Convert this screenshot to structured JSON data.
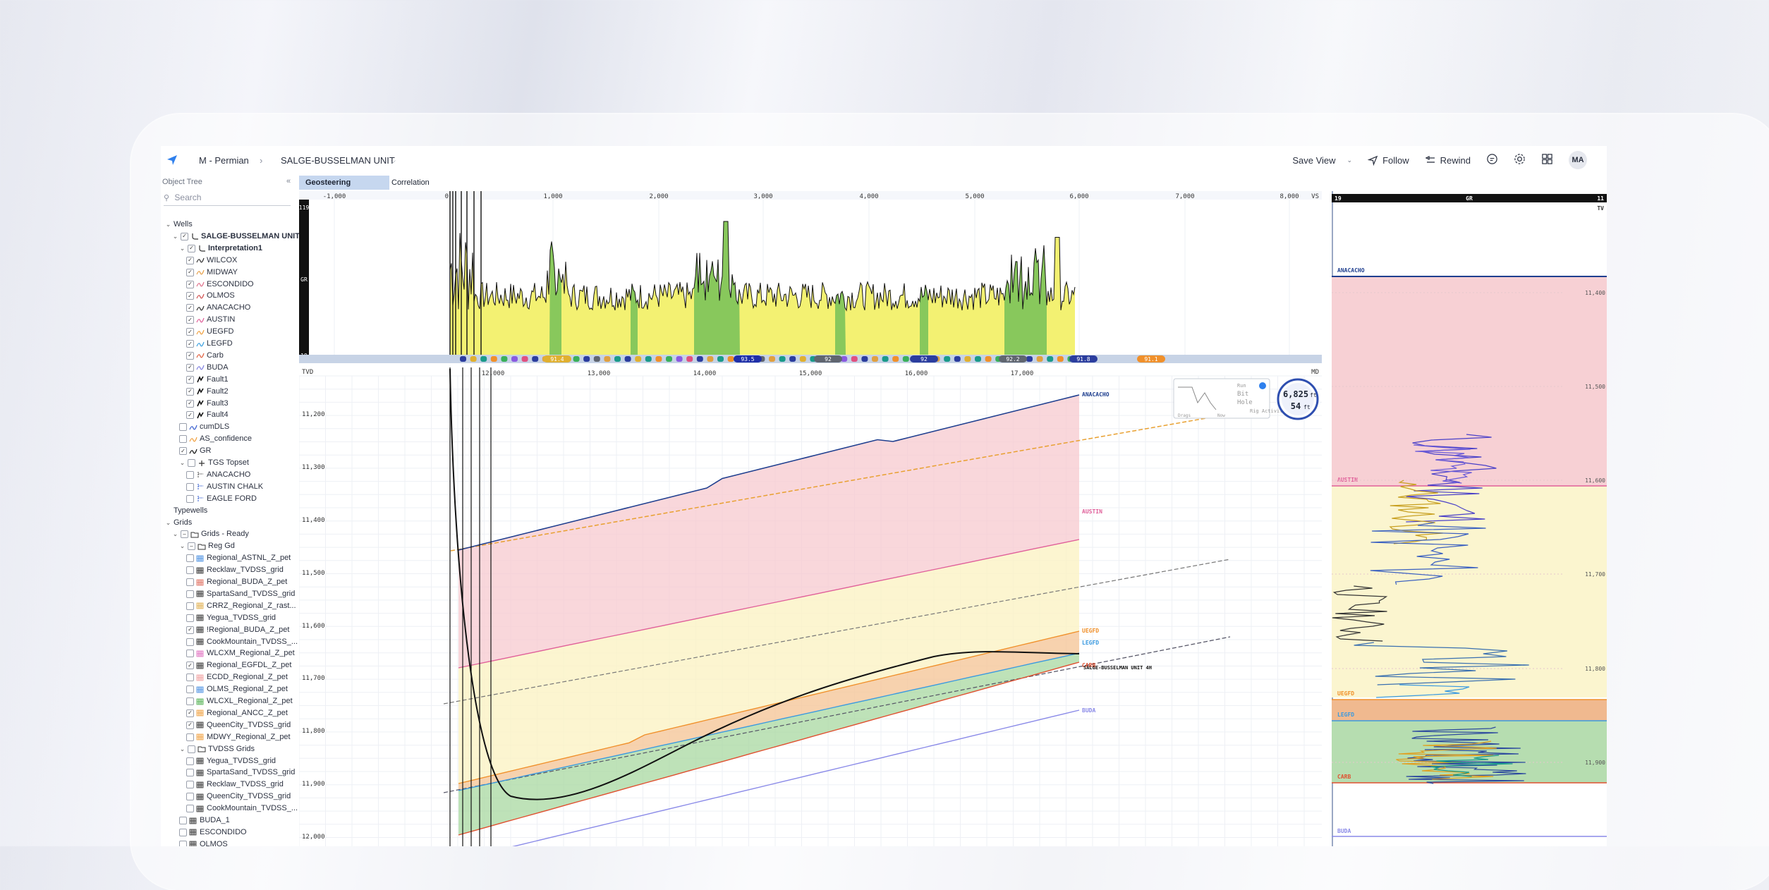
{
  "header": {
    "breadcrumb": [
      "M - Permian",
      "SALGE-BUSSELMAN UNIT"
    ],
    "save_view": "Save View",
    "follow": "Follow",
    "rewind": "Rewind",
    "user_initials": "MA"
  },
  "sidebar": {
    "title": "Object Tree",
    "collapse_icon": "«",
    "search_placeholder": "Search",
    "rows": [
      {
        "label": "Wells",
        "indent": 0,
        "chev": "v",
        "cb": null,
        "icon": null,
        "bold": false
      },
      {
        "label": "SALGE-BUSSELMAN UNIT...",
        "indent": 1,
        "chev": "v",
        "cb": "on",
        "icon": "well",
        "bold": true
      },
      {
        "label": "Interpretation1",
        "indent": 2,
        "chev": "v",
        "cb": "on",
        "icon": "well",
        "bold": true
      },
      {
        "label": "WILCOX",
        "indent": 3,
        "chev": null,
        "cb": "on",
        "icon": "horizon",
        "color": "#333",
        "bold": false
      },
      {
        "label": "MIDWAY",
        "indent": 3,
        "chev": null,
        "cb": "on",
        "icon": "horizon",
        "color": "#e6a04a",
        "bold": false
      },
      {
        "label": "ESCONDIDO",
        "indent": 3,
        "chev": null,
        "cb": "on",
        "icon": "horizon",
        "color": "#e0708a",
        "bold": false
      },
      {
        "label": "OLMOS",
        "indent": 3,
        "chev": null,
        "cb": "on",
        "icon": "horizon",
        "color": "#d05050",
        "bold": false
      },
      {
        "label": "ANACACHO",
        "indent": 3,
        "chev": null,
        "cb": "on",
        "icon": "horizon",
        "color": "#333",
        "bold": false
      },
      {
        "label": "AUSTIN",
        "indent": 3,
        "chev": null,
        "cb": "on",
        "icon": "horizon",
        "color": "#e0609a",
        "bold": false
      },
      {
        "label": "UEGFD",
        "indent": 3,
        "chev": null,
        "cb": "on",
        "icon": "horizon",
        "color": "#f0a040",
        "bold": false
      },
      {
        "label": "LEGFD",
        "indent": 3,
        "chev": null,
        "cb": "on",
        "icon": "horizon",
        "color": "#3aa0e0",
        "bold": false
      },
      {
        "label": "Carb",
        "indent": 3,
        "chev": null,
        "cb": "on",
        "icon": "horizon",
        "color": "#e06040",
        "bold": false
      },
      {
        "label": "BUDA",
        "indent": 3,
        "chev": null,
        "cb": "on",
        "icon": "horizon",
        "color": "#8080e0",
        "bold": false
      },
      {
        "label": "Fault1",
        "indent": 3,
        "chev": null,
        "cb": "on",
        "icon": "fault",
        "color": "#111",
        "bold": false
      },
      {
        "label": "Fault2",
        "indent": 3,
        "chev": null,
        "cb": "on",
        "icon": "fault",
        "color": "#111",
        "bold": false
      },
      {
        "label": "Fault3",
        "indent": 3,
        "chev": null,
        "cb": "on",
        "icon": "fault",
        "color": "#111",
        "bold": false
      },
      {
        "label": "Fault4",
        "indent": 3,
        "chev": null,
        "cb": "on",
        "icon": "fault",
        "color": "#111",
        "bold": false
      },
      {
        "label": "cumDLS",
        "indent": 2,
        "chev": null,
        "cb": "off",
        "icon": "curve",
        "color": "#3a60d0",
        "bold": false
      },
      {
        "label": "AS_confidence",
        "indent": 2,
        "chev": null,
        "cb": "off",
        "icon": "curve",
        "color": "#f0a040",
        "bold": false
      },
      {
        "label": "GR",
        "indent": 2,
        "chev": null,
        "cb": "on",
        "icon": "curve",
        "color": "#111",
        "bold": false
      },
      {
        "label": "TGS Topset",
        "indent": 2,
        "chev": "v",
        "cb": "off",
        "icon": "topset",
        "color": "#333",
        "bold": false
      },
      {
        "label": "ANACACHO",
        "indent": 3,
        "chev": null,
        "cb": "off",
        "icon": "top",
        "color": "#555",
        "bold": false
      },
      {
        "label": "AUSTIN CHALK",
        "indent": 3,
        "chev": null,
        "cb": "off",
        "icon": "top",
        "color": "#3a60d0",
        "bold": false
      },
      {
        "label": "EAGLE FORD",
        "indent": 3,
        "chev": null,
        "cb": "off",
        "icon": "top",
        "color": "#3a60d0",
        "bold": false
      },
      {
        "label": "Typewells",
        "indent": 0,
        "chev": null,
        "cb": null,
        "icon": null,
        "bold": false
      },
      {
        "label": "Grids",
        "indent": 0,
        "chev": "v",
        "cb": null,
        "icon": null,
        "bold": false
      },
      {
        "label": "Grids - Ready",
        "indent": 1,
        "chev": "v",
        "cb": "partial",
        "icon": "folder",
        "bold": false
      },
      {
        "label": "Reg Gd",
        "indent": 2,
        "chev": "v",
        "cb": "partial",
        "icon": "folder",
        "bold": false
      },
      {
        "label": "Regional_ASTNL_Z_pet",
        "indent": 3,
        "chev": null,
        "cb": "off",
        "icon": "grid",
        "color": "#4a90e2",
        "bold": false
      },
      {
        "label": "Recklaw_TVDSS_grid",
        "indent": 3,
        "chev": null,
        "cb": "off",
        "icon": "grid",
        "color": "#333",
        "bold": false
      },
      {
        "label": "Regional_BUDA_Z_pet",
        "indent": 3,
        "chev": null,
        "cb": "off",
        "icon": "grid",
        "color": "#e07060",
        "bold": false
      },
      {
        "label": "SpartaSand_TVDSS_grid",
        "indent": 3,
        "chev": null,
        "cb": "off",
        "icon": "grid",
        "color": "#333",
        "bold": false
      },
      {
        "label": "CRRZ_Regional_Z_rast...",
        "indent": 3,
        "chev": null,
        "cb": "off",
        "icon": "grid",
        "color": "#e0b050",
        "bold": false
      },
      {
        "label": "Yegua_TVDSS_grid",
        "indent": 3,
        "chev": null,
        "cb": "off",
        "icon": "grid",
        "color": "#333",
        "bold": false
      },
      {
        "label": "!Regional_BUDA_Z_pet",
        "indent": 3,
        "chev": null,
        "cb": "on",
        "icon": "grid",
        "color": "#333",
        "bold": false
      },
      {
        "label": "CookMountain_TVDSS_...",
        "indent": 3,
        "chev": null,
        "cb": "off",
        "icon": "grid",
        "color": "#333",
        "bold": false
      },
      {
        "label": "WLCXM_Regional_Z_pet",
        "indent": 3,
        "chev": null,
        "cb": "off",
        "icon": "grid",
        "color": "#e070c0",
        "bold": false
      },
      {
        "label": "Regional_EGFDL_Z_pet",
        "indent": 3,
        "chev": null,
        "cb": "on",
        "icon": "grid",
        "color": "#333",
        "bold": false
      },
      {
        "label": "ECDD_Regional_Z_pet",
        "indent": 3,
        "chev": null,
        "cb": "off",
        "icon": "grid",
        "color": "#f0a0a0",
        "bold": false
      },
      {
        "label": "OLMS_Regional_Z_pet",
        "indent": 3,
        "chev": null,
        "cb": "off",
        "icon": "grid",
        "color": "#4a90e2",
        "bold": false
      },
      {
        "label": "WLCXL_Regional_Z_pet",
        "indent": 3,
        "chev": null,
        "cb": "off",
        "icon": "grid",
        "color": "#50b050",
        "bold": false
      },
      {
        "label": "Regional_ANCC_Z_pet",
        "indent": 3,
        "chev": null,
        "cb": "on",
        "icon": "grid",
        "color": "#f0a040",
        "bold": false
      },
      {
        "label": "QueenCity_TVDSS_grid",
        "indent": 3,
        "chev": null,
        "cb": "on",
        "icon": "grid",
        "color": "#333",
        "bold": false
      },
      {
        "label": "MDWY_Regional_Z_pet",
        "indent": 3,
        "chev": null,
        "cb": "off",
        "icon": "grid",
        "color": "#f0a040",
        "bold": false
      },
      {
        "label": "TVDSS Grids",
        "indent": 2,
        "chev": "v",
        "cb": "off",
        "icon": "folder",
        "bold": false
      },
      {
        "label": "Yegua_TVDSS_grid",
        "indent": 3,
        "chev": null,
        "cb": "off",
        "icon": "grid",
        "color": "#333",
        "bold": false
      },
      {
        "label": "SpartaSand_TVDSS_grid",
        "indent": 3,
        "chev": null,
        "cb": "off",
        "icon": "grid",
        "color": "#333",
        "bold": false
      },
      {
        "label": "Recklaw_TVDSS_grid",
        "indent": 3,
        "chev": null,
        "cb": "off",
        "icon": "grid",
        "color": "#333",
        "bold": false
      },
      {
        "label": "QueenCity_TVDSS_grid",
        "indent": 3,
        "chev": null,
        "cb": "off",
        "icon": "grid",
        "color": "#333",
        "bold": false
      },
      {
        "label": "CookMountain_TVDSS_...",
        "indent": 3,
        "chev": null,
        "cb": "off",
        "icon": "grid",
        "color": "#333",
        "bold": false
      },
      {
        "label": "BUDA_1",
        "indent": 2,
        "chev": null,
        "cb": "off",
        "icon": "grid",
        "color": "#333",
        "bold": false
      },
      {
        "label": "ESCONDIDO",
        "indent": 2,
        "chev": null,
        "cb": "off",
        "icon": "grid",
        "color": "#333",
        "bold": false
      },
      {
        "label": "OLMOS",
        "indent": 2,
        "chev": null,
        "cb": "off",
        "icon": "grid",
        "color": "#333",
        "bold": false
      }
    ]
  },
  "tabs": [
    {
      "label": "Geosteering",
      "active": true
    },
    {
      "label": "Correlation Panel",
      "active": false
    }
  ],
  "gr_panel": {
    "left_scale_top": "119",
    "left_scale_bottom": "19",
    "curve_label": "GR",
    "vs_label": "VS",
    "vs_ticks": [
      "-1,000",
      "0",
      "1,000",
      "2,000",
      "3,000",
      "4,000",
      "5,000",
      "6,000",
      "7,000",
      "8,000"
    ],
    "zone_labels": [
      "91.4",
      "93.5",
      "92",
      "92",
      "92.2",
      "91.8",
      "91.1"
    ]
  },
  "cross_section": {
    "tvd_label": "TVD",
    "md_label": "MD",
    "md_ticks": [
      "12,000",
      "13,000",
      "14,000",
      "15,000",
      "16,000",
      "17,000"
    ],
    "tvd_ticks": [
      "11,200",
      "11,300",
      "11,400",
      "11,500",
      "11,600",
      "11,700",
      "11,800",
      "11,900",
      "12,000"
    ],
    "horizon_labels": [
      {
        "text": "ANACACHO",
        "color": "#1f3f8f"
      },
      {
        "text": "AUSTIN",
        "color": "#e0609a"
      },
      {
        "text": "UEGFD",
        "color": "#f0902a"
      },
      {
        "text": "LEGFD",
        "color": "#3a9ae0"
      },
      {
        "text": "CARB",
        "color": "#e05030"
      },
      {
        "text": "SALGE-BUSSELMAN UNIT 4H",
        "color": "#111111"
      },
      {
        "text": "BUDA",
        "color": "#8a8ae8"
      }
    ],
    "minimap_labels": [
      "Run",
      "Bit",
      "Hole",
      "Rig Activity",
      "Drags",
      "Now"
    ],
    "depth_badge": {
      "value": "6,825",
      "unit": "ft",
      "sub_value": "54",
      "sub_unit": "ft"
    }
  },
  "right_track": {
    "scale_left": "19",
    "curve_label": "GR",
    "scale_right": "11",
    "tvt_label": "TV",
    "tvd_ticks": [
      "11,400",
      "11,500",
      "11,600",
      "11,700",
      "11,800",
      "11,900"
    ],
    "horizon_labels": [
      {
        "text": "ANACACHO",
        "color": "#1f3f8f"
      },
      {
        "text": "AUSTIN",
        "color": "#e0609a"
      },
      {
        "text": "UEGFD",
        "color": "#f0902a"
      },
      {
        "text": "LEGFD",
        "color": "#3a9ae0"
      },
      {
        "text": "CARB",
        "color": "#e05030"
      },
      {
        "text": "BUDA",
        "color": "#8a8ae8"
      }
    ]
  }
}
